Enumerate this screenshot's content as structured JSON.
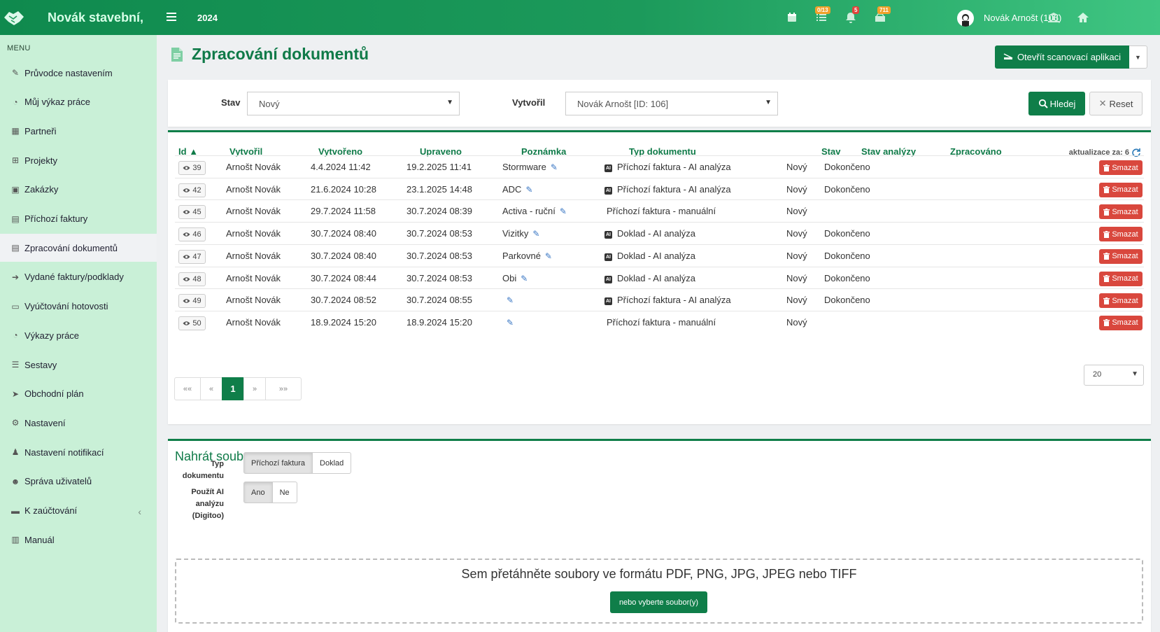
{
  "topbar": {
    "brand": "Novák stavební,",
    "year": "2024",
    "badges": {
      "tasks": "0/13",
      "notifications": "5",
      "messages": "711"
    },
    "user": "Novák Arnošt (106)"
  },
  "sidebar": {
    "header": "MENU",
    "items": [
      {
        "label": "Průvodce nastavením",
        "icon": "wrench-icon"
      },
      {
        "label": "Můj výkaz práce",
        "icon": "clock-icon"
      },
      {
        "label": "Partneři",
        "icon": "building-icon"
      },
      {
        "label": "Projekty",
        "icon": "cubes-icon"
      },
      {
        "label": "Zakázky",
        "icon": "box-icon"
      },
      {
        "label": "Příchozí faktury",
        "icon": "file-icon"
      },
      {
        "label": "Zpracování dokumentů",
        "icon": "file-icon"
      },
      {
        "label": "Vydané faktury/podklady",
        "icon": "file-export-icon"
      },
      {
        "label": "Vyúčtování hotovosti",
        "icon": "money-icon"
      },
      {
        "label": "Výkazy práce",
        "icon": "clock-icon"
      },
      {
        "label": "Sestavy",
        "icon": "list-icon"
      },
      {
        "label": "Obchodní plán",
        "icon": "paper-plane-icon"
      },
      {
        "label": "Nastavení",
        "icon": "gears-icon"
      },
      {
        "label": "Nastavení notifikací",
        "icon": "bell-icon"
      },
      {
        "label": "Správa uživatelů",
        "icon": "users-icon"
      },
      {
        "label": "K zaúčtování",
        "icon": "folder-icon"
      },
      {
        "label": "Manuál",
        "icon": "book-icon"
      }
    ]
  },
  "page": {
    "title": "Zpracování dokumentů",
    "scan_button": "Otevřít scanovací aplikaci"
  },
  "filter": {
    "stav_label": "Stav",
    "stav_value": "Nový",
    "vytvoril_label": "Vytvořil",
    "vytvoril_value": "Novák Arnošt [ID: 106]",
    "search_label": "Hledej",
    "reset_label": "Reset"
  },
  "table": {
    "headers": {
      "id": "Id",
      "vytvoril": "Vytvořil",
      "vytvoreno": "Vytvořeno",
      "upraveno": "Upraveno",
      "poznamka": "Poznámka",
      "typ": "Typ dokumentu",
      "stav": "Stav",
      "stav_analyzy": "Stav analýzy",
      "zpracovano": "Zpracováno"
    },
    "refresh_text": "aktualizace za: 6",
    "delete_label": "Smazat",
    "rows": [
      {
        "id": "39",
        "vytvoril": "Arnošt Novák",
        "vytvoreno": "4.4.2024 11:42",
        "upraveno": "19.2.2025 11:41",
        "poznamka": "Stormware",
        "typ": "Příchozí faktura - AI analýza",
        "ai": true,
        "stav": "Nový",
        "stav_analyzy": "Dokončeno",
        "zpracovano": ""
      },
      {
        "id": "42",
        "vytvoril": "Arnošt Novák",
        "vytvoreno": "21.6.2024 10:28",
        "upraveno": "23.1.2025 14:48",
        "poznamka": "ADC",
        "typ": "Příchozí faktura - AI analýza",
        "ai": true,
        "stav": "Nový",
        "stav_analyzy": "Dokončeno",
        "zpracovano": ""
      },
      {
        "id": "45",
        "vytvoril": "Arnošt Novák",
        "vytvoreno": "29.7.2024 11:58",
        "upraveno": "30.7.2024 08:39",
        "poznamka": "Activa - ruční",
        "typ": "Příchozí faktura - manuální",
        "ai": false,
        "stav": "Nový",
        "stav_analyzy": "",
        "zpracovano": ""
      },
      {
        "id": "46",
        "vytvoril": "Arnošt Novák",
        "vytvoreno": "30.7.2024 08:40",
        "upraveno": "30.7.2024 08:53",
        "poznamka": "Vizitky",
        "typ": "Doklad - AI analýza",
        "ai": true,
        "stav": "Nový",
        "stav_analyzy": "Dokončeno",
        "zpracovano": ""
      },
      {
        "id": "47",
        "vytvoril": "Arnošt Novák",
        "vytvoreno": "30.7.2024 08:40",
        "upraveno": "30.7.2024 08:53",
        "poznamka": "Parkovné",
        "typ": "Doklad - AI analýza",
        "ai": true,
        "stav": "Nový",
        "stav_analyzy": "Dokončeno",
        "zpracovano": ""
      },
      {
        "id": "48",
        "vytvoril": "Arnošt Novák",
        "vytvoreno": "30.7.2024 08:44",
        "upraveno": "30.7.2024 08:53",
        "poznamka": "Obi",
        "typ": "Doklad - AI analýza",
        "ai": true,
        "stav": "Nový",
        "stav_analyzy": "Dokončeno",
        "zpracovano": ""
      },
      {
        "id": "49",
        "vytvoril": "Arnošt Novák",
        "vytvoreno": "30.7.2024 08:52",
        "upraveno": "30.7.2024 08:55",
        "poznamka": "",
        "typ": "Příchozí faktura - AI analýza",
        "ai": true,
        "stav": "Nový",
        "stav_analyzy": "Dokončeno",
        "zpracovano": ""
      },
      {
        "id": "50",
        "vytvoril": "Arnošt Novák",
        "vytvoreno": "18.9.2024 15:20",
        "upraveno": "18.9.2024 15:20",
        "poznamka": "",
        "typ": "Příchozí faktura - manuální",
        "ai": false,
        "stav": "Nový",
        "stav_analyzy": "",
        "zpracovano": ""
      }
    ],
    "pagination": {
      "first": "««",
      "prev": "«",
      "current": "1",
      "next": "»",
      "last": "»»"
    },
    "per_page": "20"
  },
  "upload": {
    "title": "Nahrát soubory",
    "doc_type_label": "Typ dokumentu",
    "doc_type_options": [
      "Příchozí faktura",
      "Doklad"
    ],
    "ai_label": "Použít AI analýzu (Digitoo)",
    "ai_options": [
      "Ano",
      "Ne"
    ],
    "dropzone_text": "Sem přetáhněte soubory ve formátu PDF, PNG, JPG, JPEG nebo TIFF",
    "select_button": "nebo vyberte soubor(y)"
  },
  "colors": {
    "primary": "#0f7e49",
    "sidebar": "#c9f0d7",
    "danger": "#d9473d"
  }
}
